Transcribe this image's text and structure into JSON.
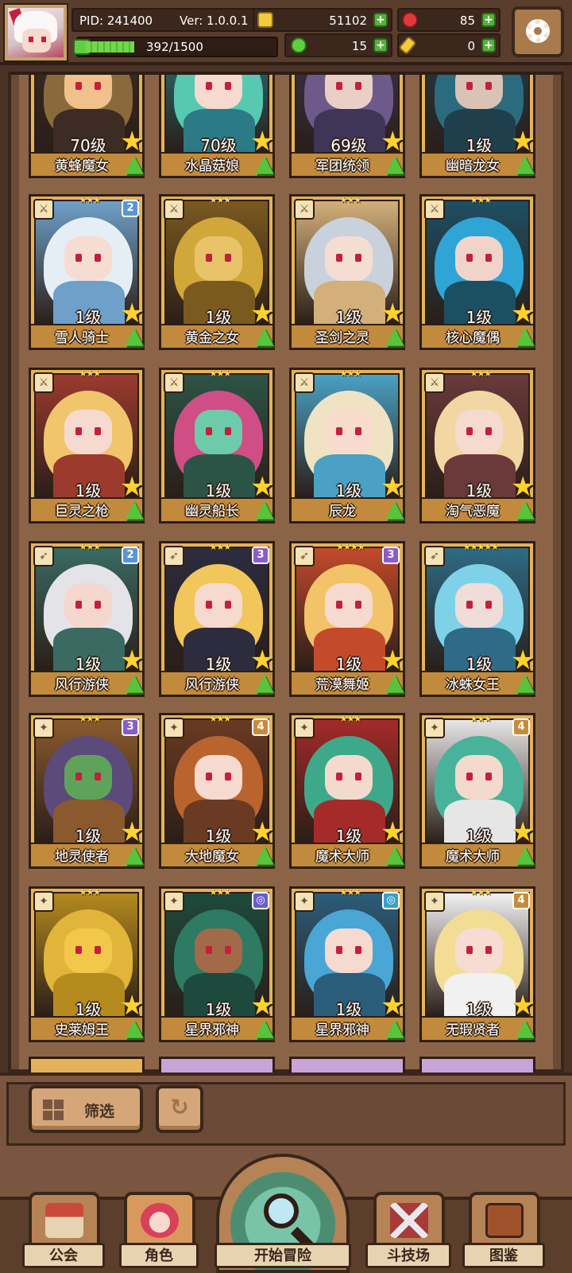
{
  "hud": {
    "pid": "PID: 241400",
    "version": "Ver: 1.0.0.1",
    "gold": "51102",
    "gems": "85",
    "clover": "15",
    "key": "0",
    "exp": "392/1500",
    "exp_progress": 0.26
  },
  "cards": [
    {
      "name": "黄蜂魔女",
      "level": "70级",
      "art": [
        "#8a6a3d",
        "#f0c18a",
        "#3d2c24"
      ],
      "cls": "",
      "stars": "",
      "badge": ""
    },
    {
      "name": "水晶菇娘",
      "level": "70级",
      "art": [
        "#57c9b0",
        "#f6d9cf",
        "#2b7a86"
      ],
      "cls": "",
      "stars": "",
      "badge": ""
    },
    {
      "name": "军团统领",
      "level": "69级",
      "art": [
        "#6d5a8a",
        "#e9cfc6",
        "#3f3557"
      ],
      "cls": "",
      "stars": "",
      "badge": ""
    },
    {
      "name": "幽暗龙女",
      "level": "1级",
      "art": [
        "#2b6b7d",
        "#d9c2b6",
        "#1f3f4d"
      ],
      "cls": "",
      "stars": "",
      "badge": ""
    },
    {
      "name": "雪人骑士",
      "level": "1级",
      "art": [
        "#e6eef5",
        "#f6ddd3",
        "#6fa0c9"
      ],
      "cls": "⚔",
      "stars": "★★★",
      "badge": "2",
      "badgeColor": "#5a95d8"
    },
    {
      "name": "黄金之女",
      "level": "1级",
      "art": [
        "#d2a73a",
        "#e8c36a",
        "#7b5a20"
      ],
      "cls": "⚔",
      "stars": "★★★",
      "badge": ""
    },
    {
      "name": "圣剑之灵",
      "level": "1级",
      "art": [
        "#c9d2dc",
        "#f4ddd2",
        "#d3b07a"
      ],
      "cls": "⚔",
      "stars": "★★★",
      "badge": ""
    },
    {
      "name": "核心魔偶",
      "level": "1级",
      "art": [
        "#2fa5d6",
        "#f0d4cc",
        "#1d4f63"
      ],
      "cls": "⚔",
      "stars": "★★★",
      "badge": ""
    },
    {
      "name": "巨灵之枪",
      "level": "1级",
      "art": [
        "#f0c56c",
        "#f6d9cf",
        "#9c3a2e"
      ],
      "cls": "⚔",
      "stars": "★★★",
      "badge": ""
    },
    {
      "name": "幽灵船长",
      "level": "1级",
      "art": [
        "#d04e86",
        "#6ecbaa",
        "#2c5446"
      ],
      "cls": "⚔",
      "stars": "★★★",
      "badge": ""
    },
    {
      "name": "辰龙",
      "level": "1级",
      "art": [
        "#efe3c4",
        "#f7dccd",
        "#4aa1c4"
      ],
      "cls": "⚔",
      "stars": "★★★",
      "badge": ""
    },
    {
      "name": "淘气恶魔",
      "level": "1级",
      "art": [
        "#f2d7a4",
        "#f6d9cf",
        "#6a3a3a"
      ],
      "cls": "⚔",
      "stars": "★★★",
      "badge": ""
    },
    {
      "name": "风行游侠",
      "level": "1级",
      "art": [
        "#e4e4e8",
        "#f4d8cd",
        "#3a6a62"
      ],
      "cls": "➶",
      "stars": "★★★",
      "badge": "2",
      "badgeColor": "#5a95d8"
    },
    {
      "name": "风行游侠",
      "level": "1级",
      "art": [
        "#f1c65a",
        "#f6d9cf",
        "#2c2c3e"
      ],
      "cls": "➶",
      "stars": "★★★",
      "badge": "3",
      "badgeColor": "#8a5cc9"
    },
    {
      "name": "荒漠舞姬",
      "level": "1级",
      "art": [
        "#f3c36a",
        "#f6d9cf",
        "#c44a2c"
      ],
      "cls": "➶",
      "stars": "★★★★",
      "badge": "3",
      "badgeColor": "#8a5cc9"
    },
    {
      "name": "冰蛛女王",
      "level": "1级",
      "art": [
        "#7fd1e8",
        "#f0dcd8",
        "#2e6b86"
      ],
      "cls": "➶",
      "stars": "★★★★★",
      "badge": ""
    },
    {
      "name": "地灵使者",
      "level": "1级",
      "art": [
        "#5b4a7a",
        "#5fa35a",
        "#8a5a2e"
      ],
      "cls": "✦",
      "stars": "★★★",
      "badge": "3",
      "badgeColor": "#8a5cc9"
    },
    {
      "name": "大地魔女",
      "level": "1级",
      "art": [
        "#b9642e",
        "#f6d9cf",
        "#6a3a22"
      ],
      "cls": "✦",
      "stars": "★★★",
      "badge": "4",
      "badgeColor": "#c78b3c"
    },
    {
      "name": "魔术大师",
      "level": "1级",
      "art": [
        "#3ea98a",
        "#f4dacd",
        "#a52a2a"
      ],
      "cls": "✦",
      "stars": "★★★",
      "badge": ""
    },
    {
      "name": "魔术大师",
      "level": "1级",
      "art": [
        "#48b39a",
        "#f4dacd",
        "#e6e6e6"
      ],
      "cls": "✦",
      "stars": "★★★",
      "badge": "4",
      "badgeColor": "#c78b3c"
    },
    {
      "name": "史莱姆王",
      "level": "1级",
      "art": [
        "#e0b53a",
        "#f1c84a",
        "#b58a1e"
      ],
      "cls": "✦",
      "stars": "★★★",
      "badge": ""
    },
    {
      "name": "星界邪神",
      "level": "1级",
      "art": [
        "#2e7a62",
        "#a36a4a",
        "#1d4a3c"
      ],
      "cls": "✦",
      "stars": "★★★",
      "badge": "◎",
      "badgeColor": "#6a5cc9"
    },
    {
      "name": "星界邪神",
      "level": "1级",
      "art": [
        "#4aa6d4",
        "#f6d9cf",
        "#2b5d7a"
      ],
      "cls": "✦",
      "stars": "★★★",
      "badge": "◎",
      "badgeColor": "#3aa0c9"
    },
    {
      "name": "无瑕贤者",
      "level": "1级",
      "art": [
        "#f3dd95",
        "#f6dcd2",
        "#f1f1f1"
      ],
      "cls": "✦",
      "stars": "★★★",
      "badge": "4",
      "badgeColor": "#c78b3c"
    }
  ],
  "peek_colors": [
    "#e3b25a",
    "#c9a4d8",
    "#c9a4d8",
    "#c9a4d8"
  ],
  "filter": {
    "label": "筛选",
    "refresh_icon": "↻"
  },
  "nav": {
    "guild": "公会",
    "role": "角色",
    "adventure": "开始冒险",
    "arena": "斗技场",
    "codex": "图鉴"
  },
  "icons": {
    "gold": "coin-icon",
    "gems": "gem-icon",
    "clover": "clover-icon",
    "key": "key-icon",
    "exp": "exp-icon",
    "settings": "gear-icon"
  }
}
